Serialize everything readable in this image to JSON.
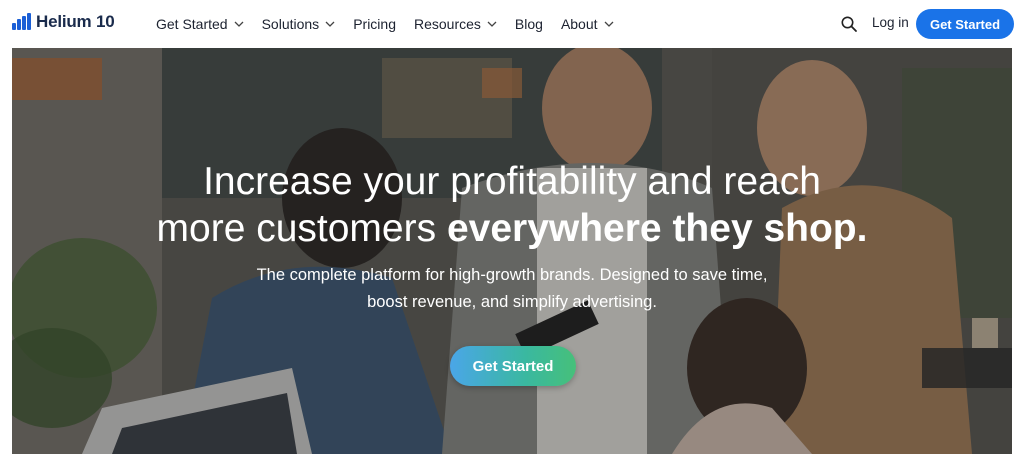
{
  "brand": {
    "name": "Helium 10",
    "logo_icon": "bar-chart-logo-icon",
    "color": "#1b5fd6"
  },
  "nav": {
    "items": [
      {
        "label": "Get Started",
        "has_dropdown": true
      },
      {
        "label": "Solutions",
        "has_dropdown": true
      },
      {
        "label": "Pricing",
        "has_dropdown": false
      },
      {
        "label": "Resources",
        "has_dropdown": true
      },
      {
        "label": "Blog",
        "has_dropdown": false
      },
      {
        "label": "About",
        "has_dropdown": true
      }
    ],
    "search_icon": "search-icon",
    "login_label": "Log in",
    "cta_label": "Get Started",
    "cta_color": "#1a73e8"
  },
  "hero": {
    "title_line1": "Increase your profitability and reach",
    "title_line2_regular": "more customers",
    "title_line2_bold": "everywhere they shop.",
    "subtitle_line1": "The complete platform for high-growth brands. Designed to save time,",
    "subtitle_line2": "boost revenue, and simplify advertising.",
    "cta_label": "Get Started"
  }
}
